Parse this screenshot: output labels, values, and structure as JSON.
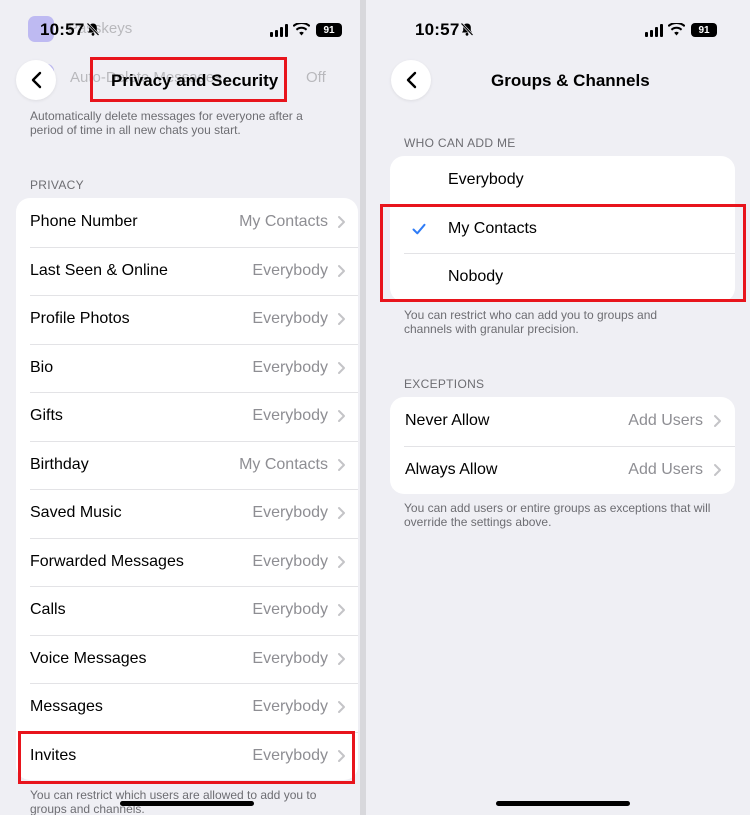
{
  "status_bar": {
    "time": "10:57",
    "battery": "91"
  },
  "left": {
    "title": "Privacy and Security",
    "ghost_passkeys": "Passkeys",
    "ghost_autodelete": "Auto-Delete Messages",
    "ghost_off": "Off",
    "autodelete_footnote": "Automatically delete messages for everyone after a period of time in all new chats you start.",
    "privacy_header": "PRIVACY",
    "rows": [
      {
        "label": "Phone Number",
        "value": "My Contacts"
      },
      {
        "label": "Last Seen & Online",
        "value": "Everybody"
      },
      {
        "label": "Profile Photos",
        "value": "Everybody"
      },
      {
        "label": "Bio",
        "value": "Everybody"
      },
      {
        "label": "Gifts",
        "value": "Everybody"
      },
      {
        "label": "Birthday",
        "value": "My Contacts"
      },
      {
        "label": "Saved Music",
        "value": "Everybody"
      },
      {
        "label": "Forwarded Messages",
        "value": "Everybody"
      },
      {
        "label": "Calls",
        "value": "Everybody"
      },
      {
        "label": "Voice Messages",
        "value": "Everybody"
      },
      {
        "label": "Messages",
        "value": "Everybody"
      },
      {
        "label": "Invites",
        "value": "Everybody"
      }
    ],
    "invites_footnote": "You can restrict which users are allowed to add you to groups and channels."
  },
  "right": {
    "title": "Groups & Channels",
    "who_header": "WHO CAN ADD ME",
    "options": [
      {
        "label": "Everybody",
        "selected": false
      },
      {
        "label": "My Contacts",
        "selected": true
      },
      {
        "label": "Nobody",
        "selected": false
      }
    ],
    "who_footnote": "You can restrict who can add you to groups and channels with granular precision.",
    "exceptions_header": "EXCEPTIONS",
    "exceptions": [
      {
        "label": "Never Allow",
        "value": "Add Users"
      },
      {
        "label": "Always Allow",
        "value": "Add Users"
      }
    ],
    "exceptions_footnote": "You can add users or entire groups as exceptions that will override the settings above."
  },
  "colors": {
    "accent": "#2f7cf6",
    "highlight": "#e8141c",
    "background": "#efeff4"
  },
  "icons": [
    "chevron-left-icon",
    "chevron-right-icon",
    "checkmark-icon",
    "bell-slash-icon",
    "wifi-icon",
    "signal-icon",
    "battery-icon"
  ]
}
